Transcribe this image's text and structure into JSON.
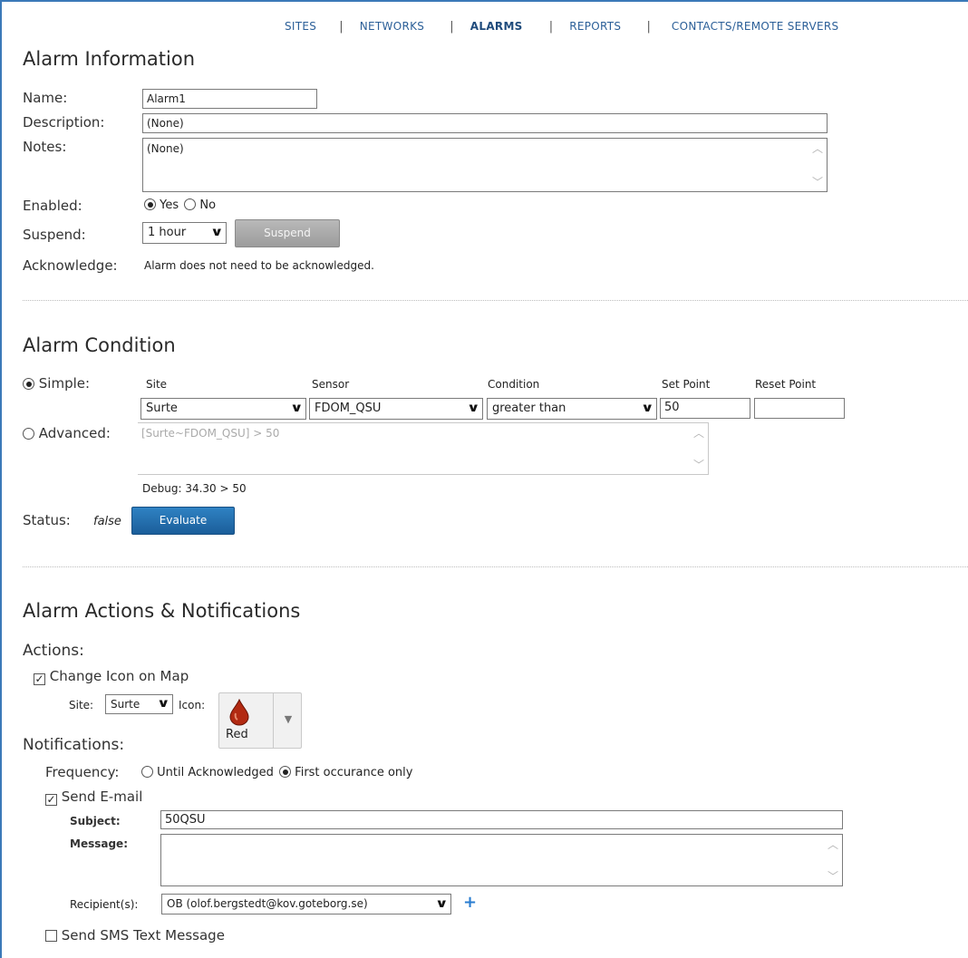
{
  "nav": {
    "items": [
      {
        "label": "SITES",
        "active": false
      },
      {
        "label": "NETWORKS",
        "active": false
      },
      {
        "label": "ALARMS",
        "active": true
      },
      {
        "label": "REPORTS",
        "active": false
      },
      {
        "label": "CONTACTS/REMOTE SERVERS",
        "active": false
      }
    ],
    "separator": "|"
  },
  "info": {
    "title": "Alarm Information",
    "name_label": "Name:",
    "name_value": "Alarm1",
    "description_label": "Description:",
    "description_value": "(None)",
    "notes_label": "Notes:",
    "notes_value": "(None)",
    "enabled_label": "Enabled:",
    "enabled_yes": "Yes",
    "enabled_no": "No",
    "enabled_selected": "Yes",
    "suspend_label": "Suspend:",
    "suspend_value": "1 hour",
    "suspend_button": "Suspend",
    "acknowledge_label": "Acknowledge:",
    "acknowledge_text": "Alarm does not need to be acknowledged."
  },
  "condition": {
    "title": "Alarm Condition",
    "simple_label": "Simple:",
    "advanced_label": "Advanced:",
    "mode_selected": "Simple",
    "columns": {
      "site": "Site",
      "sensor": "Sensor",
      "condition": "Condition",
      "set_point": "Set Point",
      "reset_point": "Reset Point"
    },
    "site_value": "Surte",
    "sensor_value": "FDOM_QSU",
    "condition_value": "greater than",
    "set_point_value": "50",
    "reset_point_value": "",
    "advanced_expression": "[Surte~FDOM_QSU] > 50",
    "debug": "Debug: 34.30 > 50",
    "status_label": "Status:",
    "status_value": "false",
    "evaluate_button": "Evaluate"
  },
  "actions": {
    "title": "Alarm Actions & Notifications",
    "actions_label": "Actions:",
    "change_icon_label": "Change Icon on Map",
    "change_icon_checked": true,
    "site_label": "Site:",
    "site_value": "Surte",
    "icon_label": "Icon:",
    "icon_name": "Red",
    "icon_color": "#b22a12",
    "notifications_label": "Notifications:",
    "frequency_label": "Frequency:",
    "frequency_option_1": "Until Acknowledged",
    "frequency_option_2": "First occurance only",
    "frequency_selected": "First occurance only",
    "send_email_label": "Send E-mail",
    "send_email_checked": true,
    "subject_label": "Subject:",
    "subject_value": "50QSU",
    "message_label": "Message:",
    "message_value": "",
    "recipients_label": "Recipient(s):",
    "recipients_value": "OB (olof.bergstedt@kov.goteborg.se)",
    "send_sms_label": "Send SMS Text Message",
    "send_sms_checked": false
  },
  "colors": {
    "link": "#2b5f98",
    "accent_border": "#3b79b8",
    "button_blue": "#1f6aa8",
    "button_grey": "#a8a8a8"
  }
}
